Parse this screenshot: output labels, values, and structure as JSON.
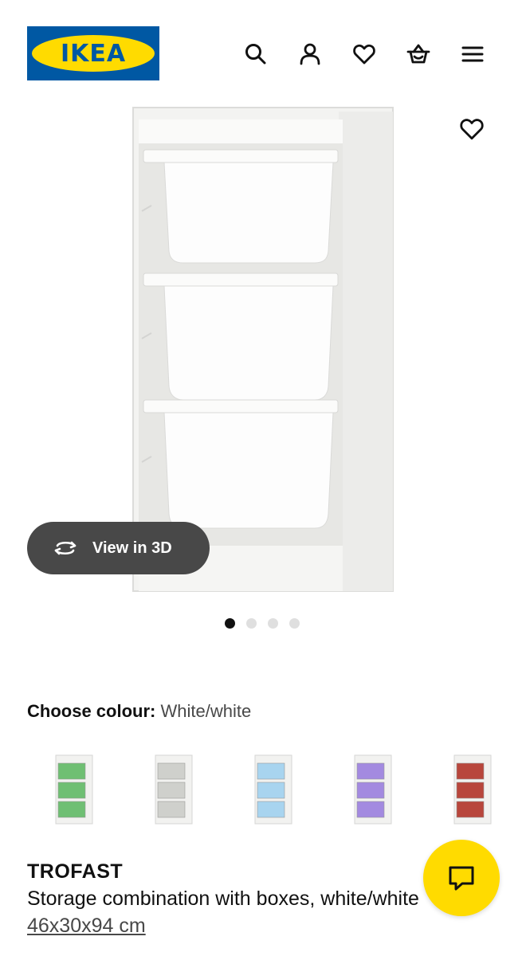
{
  "header": {
    "logo_text": "IKEA",
    "icons": [
      "search-icon",
      "user-icon",
      "heart-icon",
      "basket-icon",
      "menu-icon"
    ]
  },
  "gallery": {
    "view3d_label": "View in 3D",
    "dots_total": 4,
    "dots_active": 1
  },
  "colour": {
    "label": "Choose colour:",
    "value": "White/white",
    "options": [
      {
        "name": "green",
        "box_color": "#6fbf73"
      },
      {
        "name": "grey",
        "box_color": "#cfd0cc"
      },
      {
        "name": "blue",
        "box_color": "#a8d4ef"
      },
      {
        "name": "lilac",
        "box_color": "#a38ae0"
      },
      {
        "name": "red",
        "box_color": "#b8463c"
      }
    ]
  },
  "product": {
    "name": "TROFAST",
    "description": "Storage combination with boxes, white/white",
    "size": "46x30x94 cm"
  },
  "colors": {
    "ikea_blue": "#0058a3",
    "ikea_yellow": "#ffdb00",
    "button_dark": "#484848"
  }
}
